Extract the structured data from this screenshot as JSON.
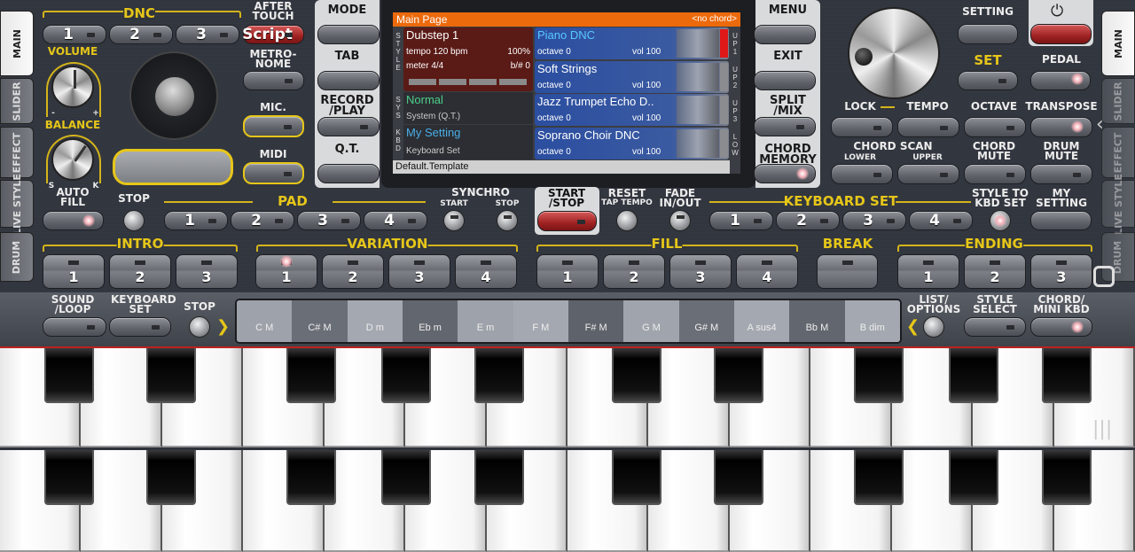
{
  "tabs_left": [
    "MAIN",
    "SLIDER",
    "EFFECT",
    "LIVE STYLE",
    "DRUM"
  ],
  "tabs_right": [
    "MAIN",
    "SLIDER",
    "EFFECT",
    "LIVE STYLE",
    "DRUM"
  ],
  "left": {
    "dnc": "DNC",
    "after_touch": "AFTER TOUCH",
    "dnc_buttons": [
      "1",
      "2",
      "3"
    ],
    "script": "Script",
    "volume": "VOLUME",
    "balance": "BALANCE",
    "minus": "-",
    "plus": "+",
    "s": "S",
    "k": "K",
    "auto_fill": "AUTO FILL",
    "metronome": "METRO- NOME",
    "mic": "MIC.",
    "midi": "MIDI"
  },
  "mode_panel": [
    "MODE",
    "TAB",
    "RECORD /PLAY",
    "Q.T."
  ],
  "menu_panel": [
    "MENU",
    "EXIT",
    "SPLIT /MIX",
    "CHORD MEMORY"
  ],
  "display": {
    "header": "Main Page",
    "chord": "<no chord>",
    "side_left": [
      [
        "S",
        "T",
        "Y",
        "L",
        "E"
      ],
      [
        "S",
        "Y",
        "S"
      ],
      [
        "K",
        "B",
        "D"
      ]
    ],
    "side_right": [
      [
        "U",
        "P",
        "1"
      ],
      [
        "U",
        "P",
        "2"
      ],
      [
        "U",
        "P",
        "3"
      ],
      [
        "L",
        "O",
        "W"
      ]
    ],
    "style": {
      "name": "Dubstep 1",
      "tempo": "tempo 120 bpm",
      "percent": "100%",
      "meter": "meter 4/4",
      "bsharp": "b/# 0"
    },
    "sys": {
      "name": "Normal",
      "sub": "System (Q.T.)"
    },
    "kbd": {
      "name": "My Setting",
      "sub": "Keyboard Set"
    },
    "voices": [
      {
        "name": "Piano DNC",
        "octave": "octave  0",
        "vol": "vol 100"
      },
      {
        "name": "Soft Strings",
        "octave": "octave  0",
        "vol": "vol 100"
      },
      {
        "name": "Jazz Trumpet Echo D..",
        "octave": "octave  0",
        "vol": "vol 100"
      },
      {
        "name": "Soprano Choir DNC",
        "octave": "octave  0",
        "vol": "vol 100"
      }
    ],
    "footer": "Default.Template"
  },
  "right": {
    "setting": "SETTING",
    "set": "SET",
    "pedal": "PEDAL",
    "lock": "LOCK",
    "tempo": "TEMPO",
    "octave": "OCTAVE",
    "transpose": "TRANSPOSE",
    "chord_scan": "CHORD SCAN",
    "lower": "LOWER",
    "upper": "UPPER",
    "chord_mute": "CHORD MUTE",
    "drum_mute": "DRUM MUTE"
  },
  "row3": {
    "stop": "STOP",
    "pad": "PAD",
    "pad_buttons": [
      "1",
      "2",
      "3",
      "4"
    ],
    "synchro": "SYNCHRO",
    "synchro_start": "START",
    "synchro_stop": "STOP",
    "start_stop": "START /STOP",
    "reset": "RESET",
    "tap_tempo": "TAP TEMPO",
    "fade": "FADE IN/OUT",
    "keyboard_set": "KEYBOARD SET",
    "kbd_buttons": [
      "1",
      "2",
      "3",
      "4"
    ],
    "style_to_kbd": "STYLE TO KBD SET",
    "my_setting": "MY SETTING"
  },
  "row4": {
    "intro": "INTRO",
    "intro_buttons": [
      "1",
      "2",
      "3"
    ],
    "variation": "VARIATION",
    "variation_buttons": [
      "1",
      "2",
      "3",
      "4"
    ],
    "fill": "FILL",
    "fill_buttons": [
      "1",
      "2",
      "3",
      "4"
    ],
    "break": "BREAK",
    "ending": "ENDING",
    "ending_buttons": [
      "1",
      "2",
      "3"
    ]
  },
  "bottom": {
    "sound_loop": "SOUND /LOOP",
    "keyboard_set": "KEYBOARD SET",
    "stop": "STOP",
    "list_options": "LIST/ OPTIONS",
    "style_select": "STYLE SELECT",
    "chord_mini": "CHORD/ MINI KBD",
    "chords": [
      "C M",
      "C# M",
      "D m",
      "Eb m",
      "E m",
      "F M",
      "F# M",
      "G M",
      "G# M",
      "A sus4",
      "Bb M",
      "B dim"
    ]
  },
  "colors": {
    "accent_yellow": "#e6c619",
    "header_orange": "#ec6a0c",
    "start_red": "#a02222"
  }
}
